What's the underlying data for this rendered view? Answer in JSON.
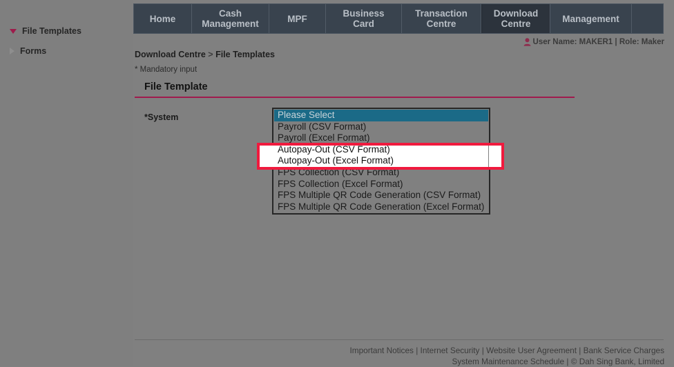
{
  "sidebar": {
    "items": [
      {
        "label": "File Templates",
        "icon": "triangle-down-icon",
        "expanded": true
      },
      {
        "label": "Forms",
        "icon": "triangle-right-icon",
        "expanded": false
      }
    ]
  },
  "topnav": {
    "tabs": [
      {
        "label": "Home",
        "active": false
      },
      {
        "label": "Cash\nManagement",
        "active": false
      },
      {
        "label": "MPF",
        "active": false
      },
      {
        "label": "Business\nCard",
        "active": false
      },
      {
        "label": "Transaction\nCentre",
        "active": false
      },
      {
        "label": "Download\nCentre",
        "active": true
      },
      {
        "label": "Management",
        "active": false
      }
    ]
  },
  "user": {
    "icon": "person-icon",
    "text": "User Name: MAKER1 | Role: Maker"
  },
  "content": {
    "breadcrumb_parent": "Download Centre",
    "breadcrumb_sep": ">",
    "breadcrumb_current": "File Templates",
    "mandatory_note": "* Mandatory input",
    "section_title": "File Template",
    "system_label": "*System"
  },
  "system_select": {
    "selected_value": "Please Select",
    "options": [
      {
        "label": "Please Select",
        "state": "selected"
      },
      {
        "label": "Payroll (CSV Format)",
        "state": "normal"
      },
      {
        "label": "Payroll (Excel Format)",
        "state": "normal"
      },
      {
        "label": "Autopay-Out (CSV Format)",
        "state": "highlighted"
      },
      {
        "label": "Autopay-Out (Excel Format)",
        "state": "highlighted"
      },
      {
        "label": "FPS Collection (CSV Format)",
        "state": "normal"
      },
      {
        "label": "FPS Collection (Excel Format)",
        "state": "normal"
      },
      {
        "label": "FPS Multiple QR Code Generation (CSV Format)",
        "state": "normal"
      },
      {
        "label": "FPS Multiple QR Code Generation (Excel Format)",
        "state": "normal"
      }
    ]
  },
  "annotation": {
    "color": "#f01a3e",
    "target": "Autopay-Out options"
  },
  "footer": {
    "line1": [
      "Important Notices",
      "Internet Security",
      "Website User Agreement",
      "Bank Service Charges"
    ],
    "line2": [
      "System Maintenance Schedule",
      "© Dah Sing Bank, Limited"
    ],
    "separator": " | "
  }
}
